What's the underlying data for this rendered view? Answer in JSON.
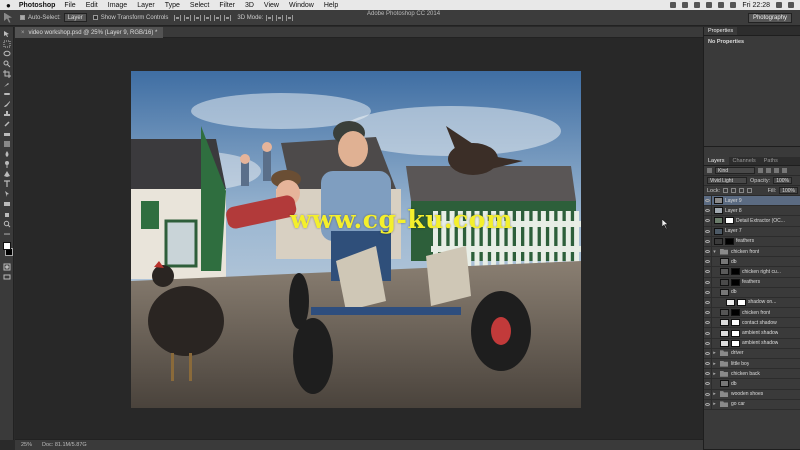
{
  "menubar": {
    "app": "Photoshop",
    "items": [
      "File",
      "Edit",
      "Image",
      "Layer",
      "Type",
      "Select",
      "Filter",
      "3D",
      "View",
      "Window",
      "Help"
    ],
    "clock": "Fri 22:28"
  },
  "window_title": "Adobe Photoshop CC 2014",
  "options": {
    "auto_select_label": "Auto-Select:",
    "auto_select_target": "Layer",
    "transform_label": "Show Transform Controls",
    "mode_3d": "3D Mode:",
    "workspace": "Photography"
  },
  "document": {
    "tab_label": "video workshop.psd @ 25% (Layer 9, RGB/16) *",
    "watermark": "www.cg-ku.com"
  },
  "status": {
    "zoom": "25%",
    "doc_size": "Doc: 81.1M/5.87G"
  },
  "properties": {
    "tabs": [
      "Properties"
    ],
    "body": "No Properties"
  },
  "layers": {
    "tabs": [
      "Layers",
      "Channels",
      "Paths"
    ],
    "kind_filter": "Kind",
    "blend_mode": "Vivid Light",
    "opacity_label": "Opacity:",
    "opacity": "100%",
    "lock_label": "Lock:",
    "fill_label": "Fill:",
    "fill": "100%",
    "items": [
      {
        "name": "Layer 9",
        "type": "layer",
        "indent": 0,
        "selected": true,
        "thumb": "#8a8a8a"
      },
      {
        "name": "Layer 8",
        "type": "layer",
        "indent": 0,
        "thumb": "#a0a8b0"
      },
      {
        "name": "Detail Extractor (OC...",
        "type": "layer",
        "indent": 0,
        "thumb": "#6b7d6b",
        "mask": "#ffffff"
      },
      {
        "name": "Layer 7",
        "type": "layer",
        "indent": 0,
        "thumb": "#4d5a66"
      },
      {
        "name": "feathers",
        "type": "layer",
        "indent": 0,
        "thumb": "#3a3a3a",
        "mask": "#000000"
      },
      {
        "name": "chicken front",
        "type": "folder",
        "indent": 0,
        "open": true
      },
      {
        "name": "db",
        "type": "layer",
        "indent": 1,
        "thumb": "#777777"
      },
      {
        "name": "chicken right cu...",
        "type": "layer",
        "indent": 1,
        "thumb": "#5a5a5a",
        "mask": "#000000"
      },
      {
        "name": "feathers",
        "type": "layer",
        "indent": 1,
        "thumb": "#4a4a4a",
        "mask": "#000000"
      },
      {
        "name": "db",
        "type": "layer",
        "indent": 1,
        "thumb": "#777777"
      },
      {
        "name": "shadow on...",
        "type": "layer",
        "indent": 2,
        "thumb": "#eeeeee",
        "mask": "#ffffff"
      },
      {
        "name": "chicken front",
        "type": "layer",
        "indent": 1,
        "thumb": "#555555",
        "mask": "#000000"
      },
      {
        "name": "contact shadow",
        "type": "layer",
        "indent": 1,
        "thumb": "#dddddd",
        "mask": "#ffffff"
      },
      {
        "name": "ambient shadow",
        "type": "layer",
        "indent": 1,
        "thumb": "#dddddd",
        "mask": "#ffffff"
      },
      {
        "name": "ambient shadow",
        "type": "layer",
        "indent": 1,
        "thumb": "#dddddd",
        "mask": "#ffffff"
      },
      {
        "name": "driver",
        "type": "folder",
        "indent": 0
      },
      {
        "name": "little boy",
        "type": "folder",
        "indent": 0
      },
      {
        "name": "chicken back",
        "type": "folder",
        "indent": 0
      },
      {
        "name": "db",
        "type": "layer",
        "indent": 1,
        "thumb": "#777777"
      },
      {
        "name": "wooden shoes",
        "type": "folder",
        "indent": 0
      },
      {
        "name": "go car",
        "type": "folder",
        "indent": 0
      }
    ]
  }
}
